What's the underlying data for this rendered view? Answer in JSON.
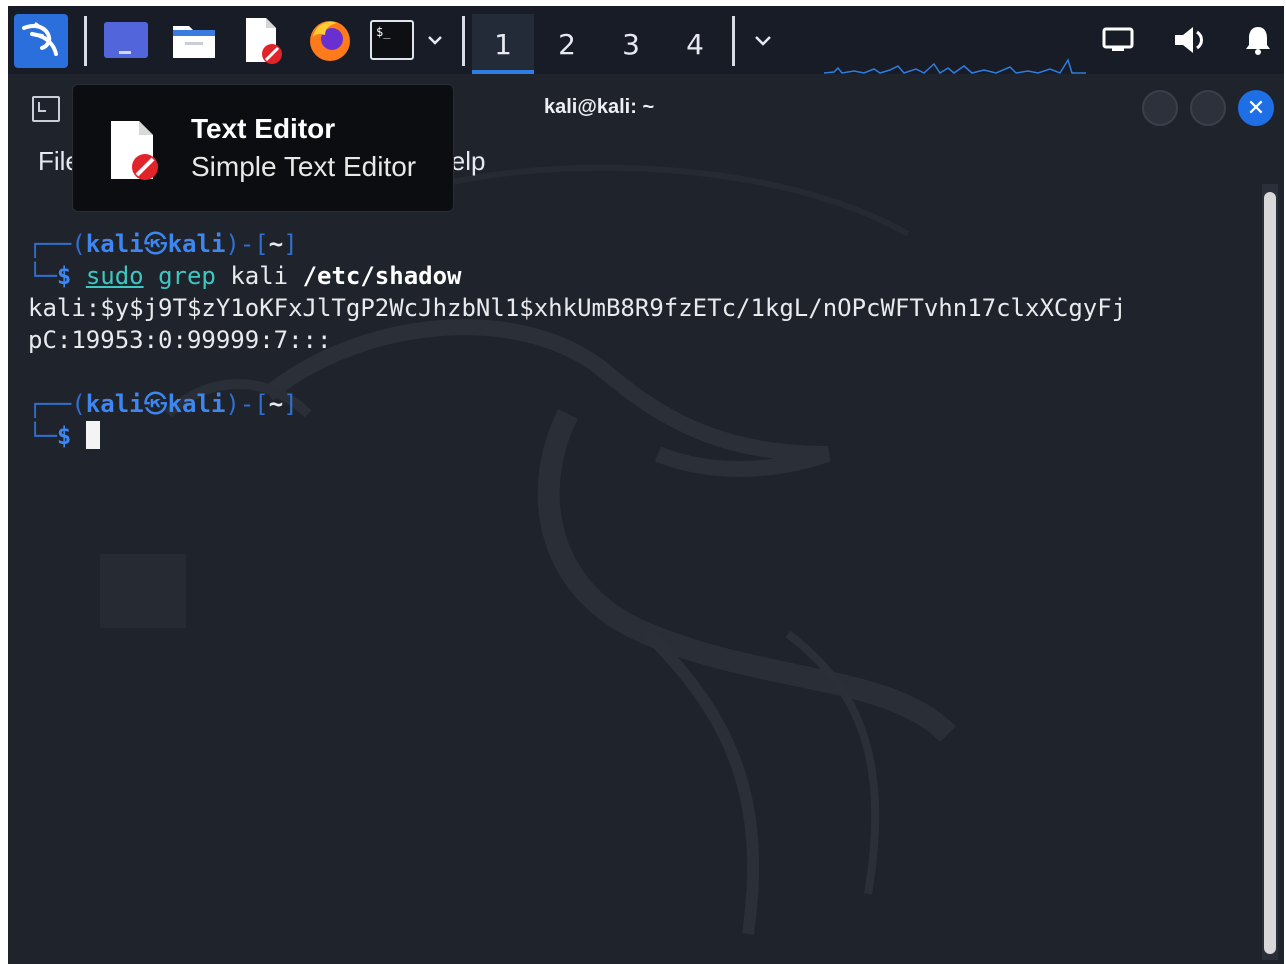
{
  "panel": {
    "workspaces": [
      {
        "label": "1",
        "active": true
      },
      {
        "label": "2",
        "active": false
      },
      {
        "label": "3",
        "active": false
      },
      {
        "label": "4",
        "active": false
      }
    ],
    "launchers": [
      "kali-menu-icon",
      "show-desktop-icon",
      "file-manager-icon",
      "text-editor-icon",
      "firefox-icon",
      "terminal-icon"
    ],
    "tray": [
      "network-icon",
      "volume-icon",
      "notification-bell-icon"
    ],
    "accent_color": "#2f7de1"
  },
  "window": {
    "title": "kali@kali: ~",
    "menu": {
      "file_label": "File",
      "help_label": "Help"
    }
  },
  "terminal": {
    "prompt1": {
      "box_top": "┌──(",
      "user": "kali",
      "skull": "㉿",
      "host": "kali",
      "close_paren": ")-[",
      "dir": "~",
      "close_bracket": "]",
      "box_bottom": "└─",
      "dollar": "$"
    },
    "command": {
      "sudo": "sudo",
      "grep": "grep",
      "arg": "kali",
      "path": "/etc/shadow"
    },
    "output_line1": "kali:$y$j9T$zY1oKFxJlTgP2WcJhzbNl1$xhkUmB8R9fzETc/1kgL/nOPcWFTvhn17clxXCgyFj",
    "output_line2": "pC:19953:0:99999:7:::",
    "prompt2": {
      "box_top": "┌──(",
      "user": "kali",
      "skull": "㉿",
      "host": "kali",
      "close_paren": ")-[",
      "dir": "~",
      "close_bracket": "]",
      "box_bottom": "└─",
      "dollar": "$"
    }
  },
  "tooltip": {
    "title": "Text Editor",
    "subtitle": "Simple Text Editor",
    "icon": "text-editor-icon"
  }
}
